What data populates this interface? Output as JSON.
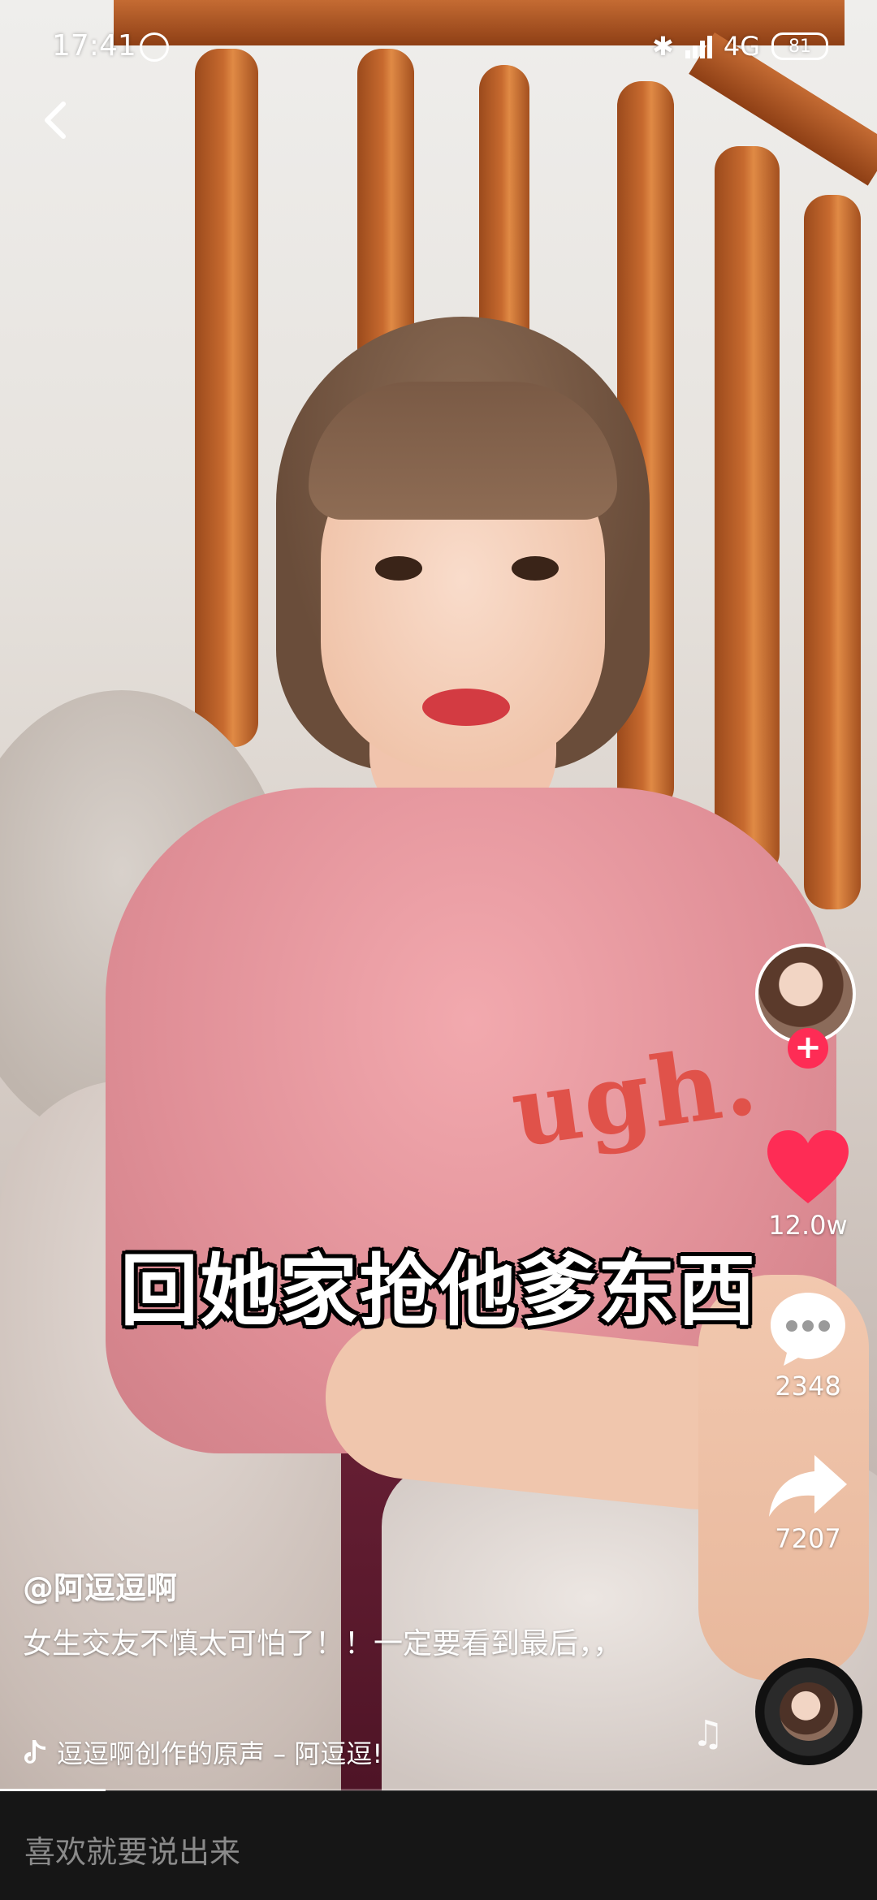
{
  "status_bar": {
    "time": "17:41",
    "network": "4G",
    "battery": "81"
  },
  "video": {
    "subtitle": "回她家抢他爹东西",
    "shirt_text": "ugh."
  },
  "actions": {
    "likes": "12.0w",
    "comments": "2348",
    "shares": "7207",
    "follow_symbol": "+"
  },
  "info": {
    "author": "@阿逗逗啊",
    "description": "女生交友不慎太可怕了！！一定要看到最后，，",
    "music": "逗逗啊创作的原声 – 阿逗逗!"
  },
  "playback": {
    "progress": 0.12
  },
  "comment_bar": {
    "placeholder": "喜欢就要说出来"
  },
  "colors": {
    "accent": "#fe2c55",
    "comment_bar_bg": "#161616"
  }
}
